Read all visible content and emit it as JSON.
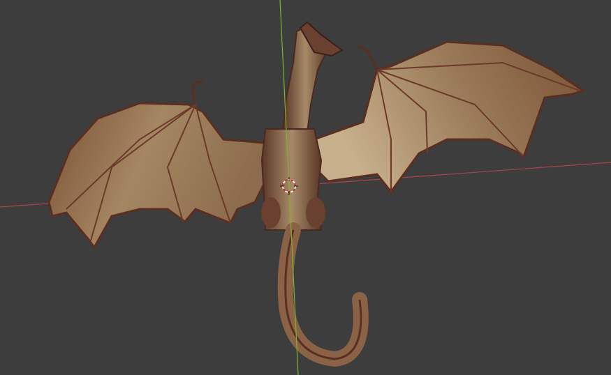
{
  "viewport": {
    "background_color": "#3d3d3d",
    "x_axis_color": "#a8434f",
    "y_axis_color": "#7fb32e",
    "model": "dragon",
    "model_colors": {
      "wing_membrane": "#8e6e4c",
      "wing_light": "#c4ab86",
      "bone": "#6b3a2a",
      "body": "#7a5a40"
    },
    "cursor_icon": "3d-cursor-icon"
  }
}
